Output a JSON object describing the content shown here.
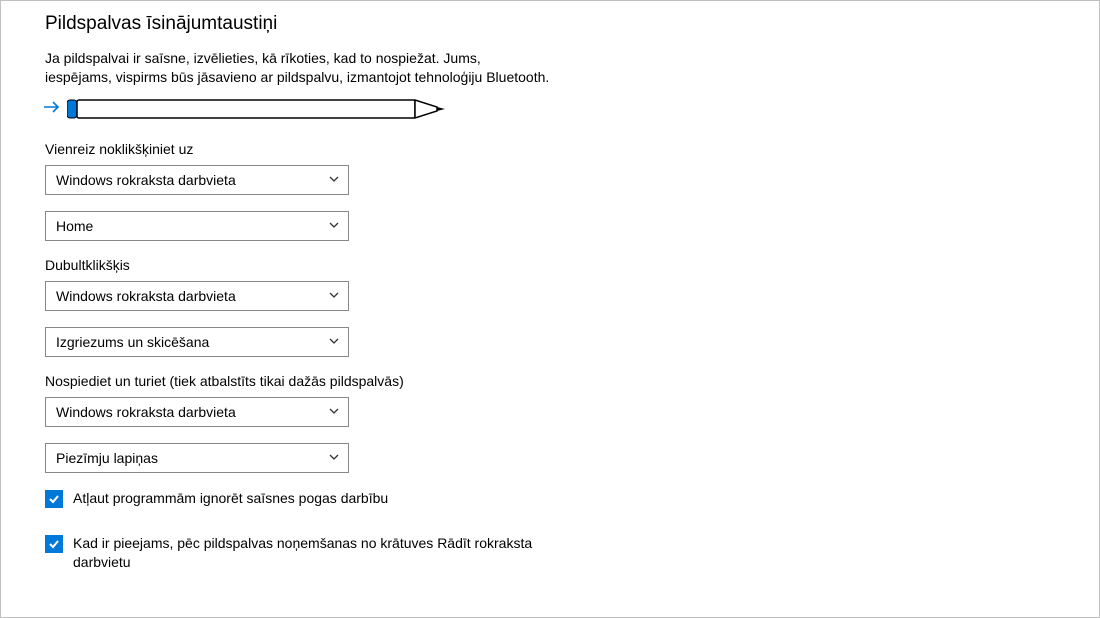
{
  "title": "Pildspalvas īsinājumtaustiņi",
  "description_line1": "Ja pildspalvai ir saīsne, izvēlieties, kā rīkoties, kad to nospiežat. Jums,",
  "description_line2": "iespējams, vispirms būs jāsavieno ar pildspalvu, izmantojot tehnoloģiju Bluetooth.",
  "single_click": {
    "label": "Vienreiz noklikšķiniet uz",
    "primary": "Windows rokraksta darbvieta",
    "secondary": "Home"
  },
  "double_click": {
    "label": "Dubultklikšķis",
    "primary": "Windows rokraksta darbvieta",
    "secondary": "Izgriezums un skicēšana"
  },
  "press_hold": {
    "label": "Nospiediet un turiet (tiek atbalstīts tikai dažās pildspalvās)",
    "primary": "Windows rokraksta darbvieta",
    "secondary": "Piezīmju lapiņas"
  },
  "checkbox1": {
    "checked": true,
    "label": "Atļaut programmām ignorēt saīsnes pogas darbību"
  },
  "checkbox2": {
    "checked": true,
    "label": "Kad ir pieejams, pēc pildspalvas noņemšanas no krātuves Rādīt rokraksta darbvietu"
  },
  "colors": {
    "accent": "#0078d7"
  }
}
